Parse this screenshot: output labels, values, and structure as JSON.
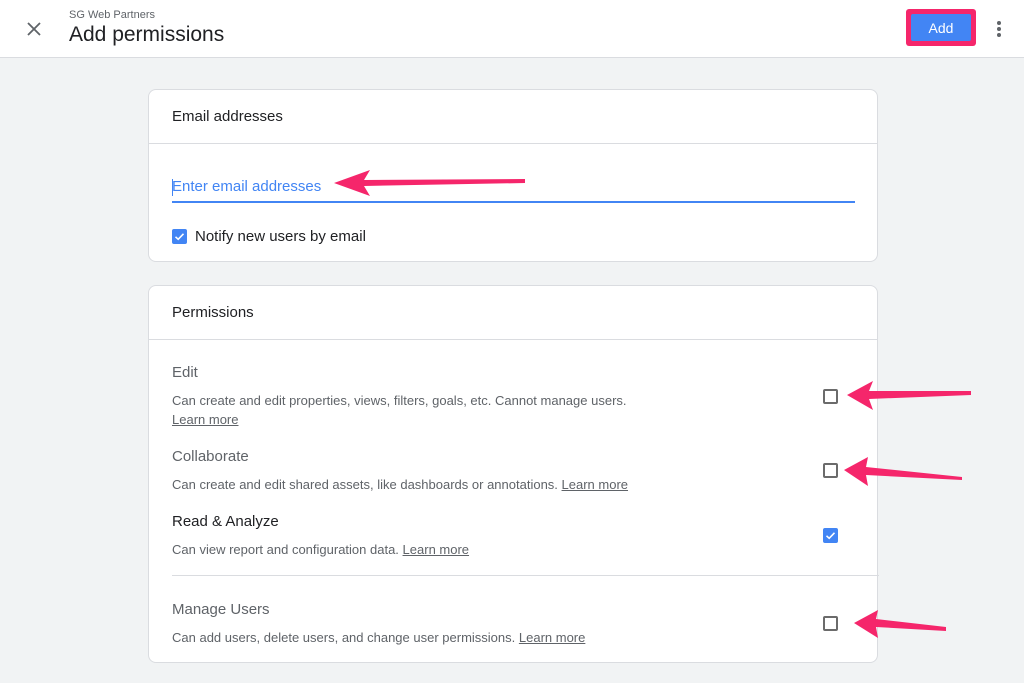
{
  "header": {
    "account_name": "SG Web Partners",
    "title": "Add permissions",
    "add_label": "Add",
    "close_icon": "close-icon",
    "more_icon": "more-vert-icon"
  },
  "email_section": {
    "title": "Email addresses",
    "input_placeholder": "Enter email addresses",
    "input_value": "",
    "notify_label": "Notify new users by email",
    "notify_checked": true
  },
  "permissions_section": {
    "title": "Permissions",
    "items": [
      {
        "title": "Edit",
        "description": "Can create and edit properties, views, filters, goals, etc. Cannot manage users.",
        "link": "Learn more",
        "checked": false
      },
      {
        "title": "Collaborate",
        "description": "Can create and edit shared assets, like dashboards or annotations.",
        "link": "Learn more",
        "checked": false
      },
      {
        "title": "Read & Analyze",
        "description": "Can view report and configuration data.",
        "link": "Learn more",
        "checked": true
      },
      {
        "title": "Manage Users",
        "description": "Can add users, delete users, and change user permissions.",
        "link": "Learn more",
        "checked": false
      }
    ]
  },
  "colors": {
    "accent": "#4285f4",
    "annotation": "#f5266b",
    "background": "#f1f3f4"
  }
}
